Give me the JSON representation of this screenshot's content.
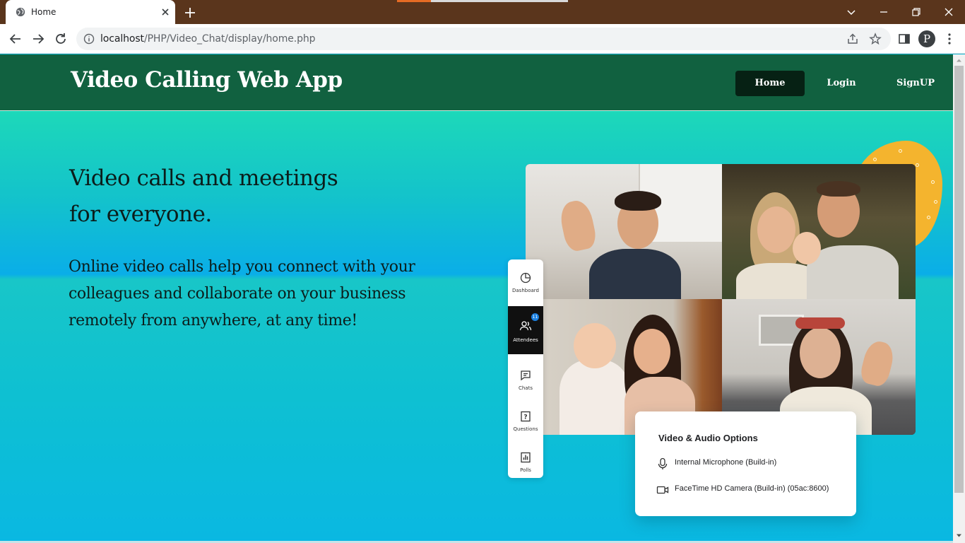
{
  "browser": {
    "tab_title": "Home",
    "url_host": "localhost",
    "url_path": "/PHP/Video_Chat/display/home.php",
    "profile_initial": "P"
  },
  "header": {
    "brand": "Video Calling Web App",
    "nav": [
      {
        "label": "Home",
        "active": true
      },
      {
        "label": "Login",
        "active": false
      },
      {
        "label": "SignUP",
        "active": false
      }
    ]
  },
  "hero": {
    "title_line1": "Video calls and meetings",
    "title_line2": "for everyone.",
    "text": "Online video calls help you connect with your colleagues and collaborate on your business remotely from anywhere, at any time!"
  },
  "side_panel": {
    "items": [
      {
        "label": "Dashboard",
        "icon": "pie-chart-icon"
      },
      {
        "label": "Attendees",
        "icon": "people-icon",
        "badge": "11"
      },
      {
        "label": "Chats",
        "icon": "chat-icon"
      },
      {
        "label": "Questions",
        "icon": "question-icon"
      },
      {
        "label": "Polls",
        "icon": "poll-icon"
      }
    ]
  },
  "options_card": {
    "title": "Video & Audio Options",
    "microphone": "Internal Microphone (Build-in)",
    "camera": "FaceTime HD Camera (Build-in) (05ac:8600)"
  },
  "colors": {
    "header_bg": "#116140",
    "active_nav": "#062114",
    "accent_blob": "#f4b42e",
    "titlebar": "#5a351c"
  }
}
